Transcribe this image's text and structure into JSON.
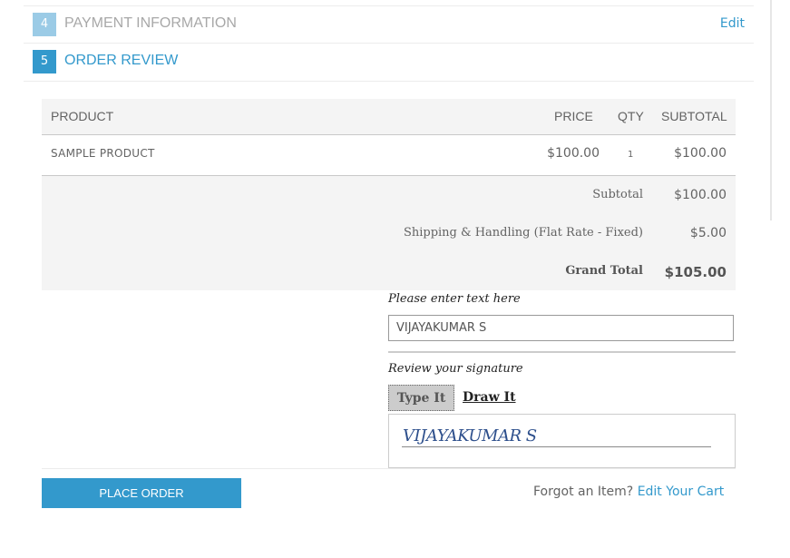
{
  "steps": [
    {
      "number": "4",
      "title": "PAYMENT INFORMATION",
      "edit_label": "Edit"
    },
    {
      "number": "5",
      "title": "ORDER REVIEW"
    }
  ],
  "table": {
    "headers": {
      "product": "PRODUCT",
      "price": "PRICE",
      "qty": "QTY",
      "subtotal": "SUBTOTAL"
    },
    "items": [
      {
        "name": "SAMPLE PRODUCT",
        "price": "$100.00",
        "qty": "1",
        "subtotal": "$100.00"
      }
    ],
    "totals": [
      {
        "label": "Subtotal",
        "value": "$100.00"
      },
      {
        "label": "Shipping & Handling (Flat Rate - Fixed)",
        "value": "$5.00"
      },
      {
        "label": "Grand Total",
        "value": "$105.00"
      }
    ]
  },
  "signature": {
    "prompt": "Please enter text here",
    "input_value": "VIJAYAKUMAR S",
    "review_label": "Review your signature",
    "tab_type": "Type It",
    "tab_draw": "Draw It",
    "rendered": "VIJAYAKUMAR S"
  },
  "footer": {
    "place_order": "PLACE ORDER",
    "forgot_text": "Forgot an Item?",
    "edit_cart": "Edit Your Cart"
  },
  "colors": {
    "accent": "#3399cc",
    "step_done": "#9bcbe6",
    "table_bg": "#f4f4f4"
  }
}
